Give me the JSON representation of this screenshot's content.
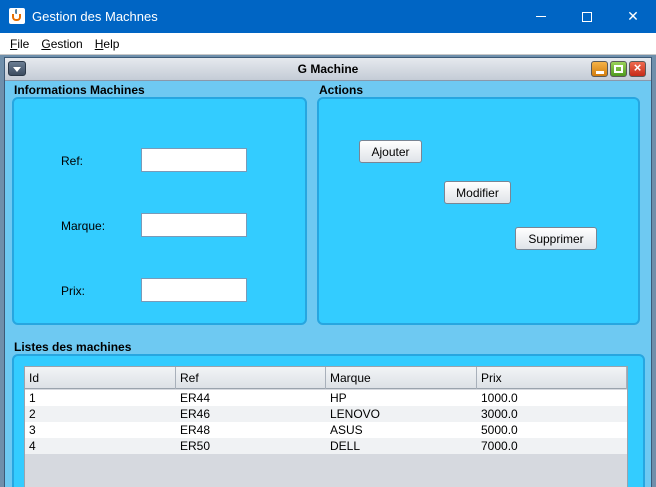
{
  "window": {
    "title": "Gestion des Machnes",
    "controls": [
      "minimize",
      "maximize",
      "close"
    ]
  },
  "menu": {
    "items": [
      {
        "label_pre": "",
        "mnemonic": "F",
        "label_post": "ile"
      },
      {
        "label_pre": "",
        "mnemonic": "G",
        "label_post": "estion"
      },
      {
        "label_pre": "",
        "mnemonic": "H",
        "label_post": "elp"
      }
    ]
  },
  "internal_frame": {
    "title": "G Machine"
  },
  "info_panel": {
    "heading": "Informations Machines",
    "fields": [
      {
        "label": "Ref:",
        "value": ""
      },
      {
        "label": "Marque:",
        "value": ""
      },
      {
        "label": "Prix:",
        "value": ""
      }
    ]
  },
  "actions_panel": {
    "heading": "Actions",
    "buttons": {
      "add": "Ajouter",
      "edit": "Modifier",
      "delete": "Supprimer"
    }
  },
  "list_panel": {
    "heading": "Listes des machines",
    "columns": [
      "Id",
      "Ref",
      "Marque",
      "Prix"
    ],
    "rows": [
      [
        "1",
        "ER44",
        "HP",
        "1000.0"
      ],
      [
        "2",
        "ER46",
        "LENOVO",
        "3000.0"
      ],
      [
        "3",
        "ER48",
        "ASUS",
        "5000.0"
      ],
      [
        "4",
        "ER50",
        "DELL",
        "7000.0"
      ]
    ]
  },
  "colors": {
    "titlebar": "#0065c4",
    "panel_fill": "#33ccff",
    "frame_bg": "#6ec9f2"
  }
}
